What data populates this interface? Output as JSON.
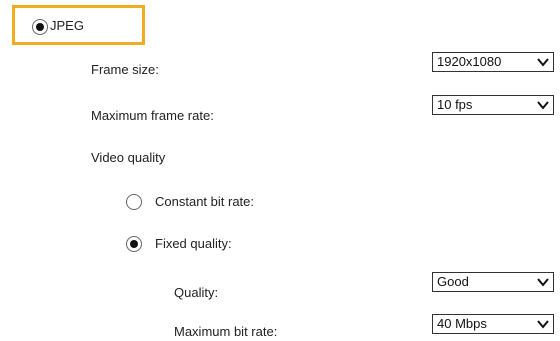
{
  "format": {
    "jpeg_label": "JPEG",
    "jpeg_selected": true
  },
  "frame_size": {
    "label": "Frame size:",
    "value": "1920x1080"
  },
  "max_frame_rate": {
    "label": "Maximum frame rate:",
    "value": "10 fps"
  },
  "video_quality": {
    "label": "Video quality",
    "constant_bit_rate": {
      "label": "Constant bit rate:",
      "selected": false
    },
    "fixed_quality": {
      "label": "Fixed quality:",
      "selected": true
    }
  },
  "quality": {
    "label": "Quality:",
    "value": "Good"
  },
  "max_bit_rate": {
    "label": "Maximum bit rate:",
    "value": "40 Mbps"
  },
  "colors": {
    "highlight": "#f0ad1f"
  },
  "icons": {
    "dropdown": "chevron-down-icon"
  }
}
